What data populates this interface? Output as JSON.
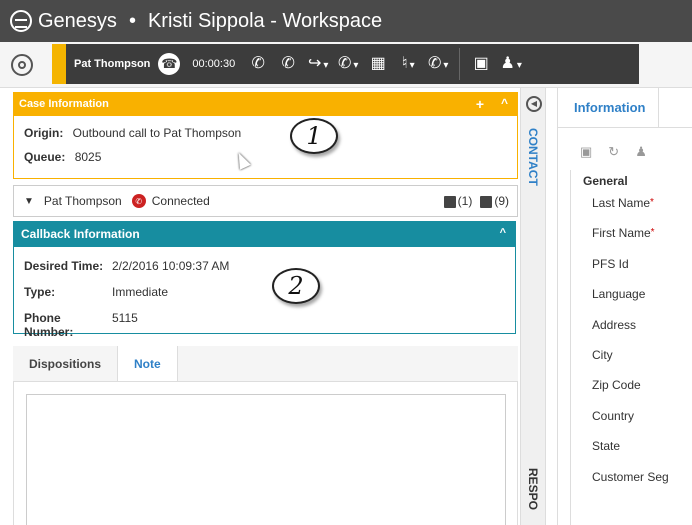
{
  "titlebar": {
    "brand": "Genesys",
    "separator": "•",
    "title": "Kristi Sippola - Workspace"
  },
  "toolbar": {
    "caller": "Pat Thompson",
    "timer": "00:00:30",
    "icons": [
      "end-call-icon",
      "hold-icon",
      "transfer-icon",
      "conference-icon",
      "keypad-icon",
      "mute-icon",
      "voicemail-icon",
      "calendar-icon",
      "agent-status-icon"
    ]
  },
  "case_info": {
    "header": "Case Information",
    "plus": "+",
    "collapse": "^",
    "origin_label": "Origin:",
    "origin_value": "Outbound call to Pat Thompson",
    "queue_label": "Queue:",
    "queue_value": "8025"
  },
  "contact": {
    "name": "Pat Thompson",
    "status": "Connected",
    "cases_count": "(1)",
    "history_count": "(9)"
  },
  "callback": {
    "header": "Callback Information",
    "collapse": "^",
    "desired_label": "Desired Time:",
    "desired_value": "2/2/2016 10:09:37 AM",
    "type_label": "Type:",
    "type_value": "Immediate",
    "phone_label": "Phone Number:",
    "phone_value": "5115"
  },
  "tabs": {
    "dispositions": "Dispositions",
    "note": "Note"
  },
  "side": {
    "contact": "CONTACT",
    "respo": "RESPO"
  },
  "right": {
    "tab_info": "Information",
    "group": "General",
    "fields": [
      "Last Name",
      "First Name",
      "PFS Id",
      "Language",
      "Address",
      "City",
      "Zip Code",
      "Country",
      "State",
      "Customer Seg"
    ],
    "required_marker": "*"
  },
  "annotations": {
    "one": "1",
    "two": "2"
  }
}
